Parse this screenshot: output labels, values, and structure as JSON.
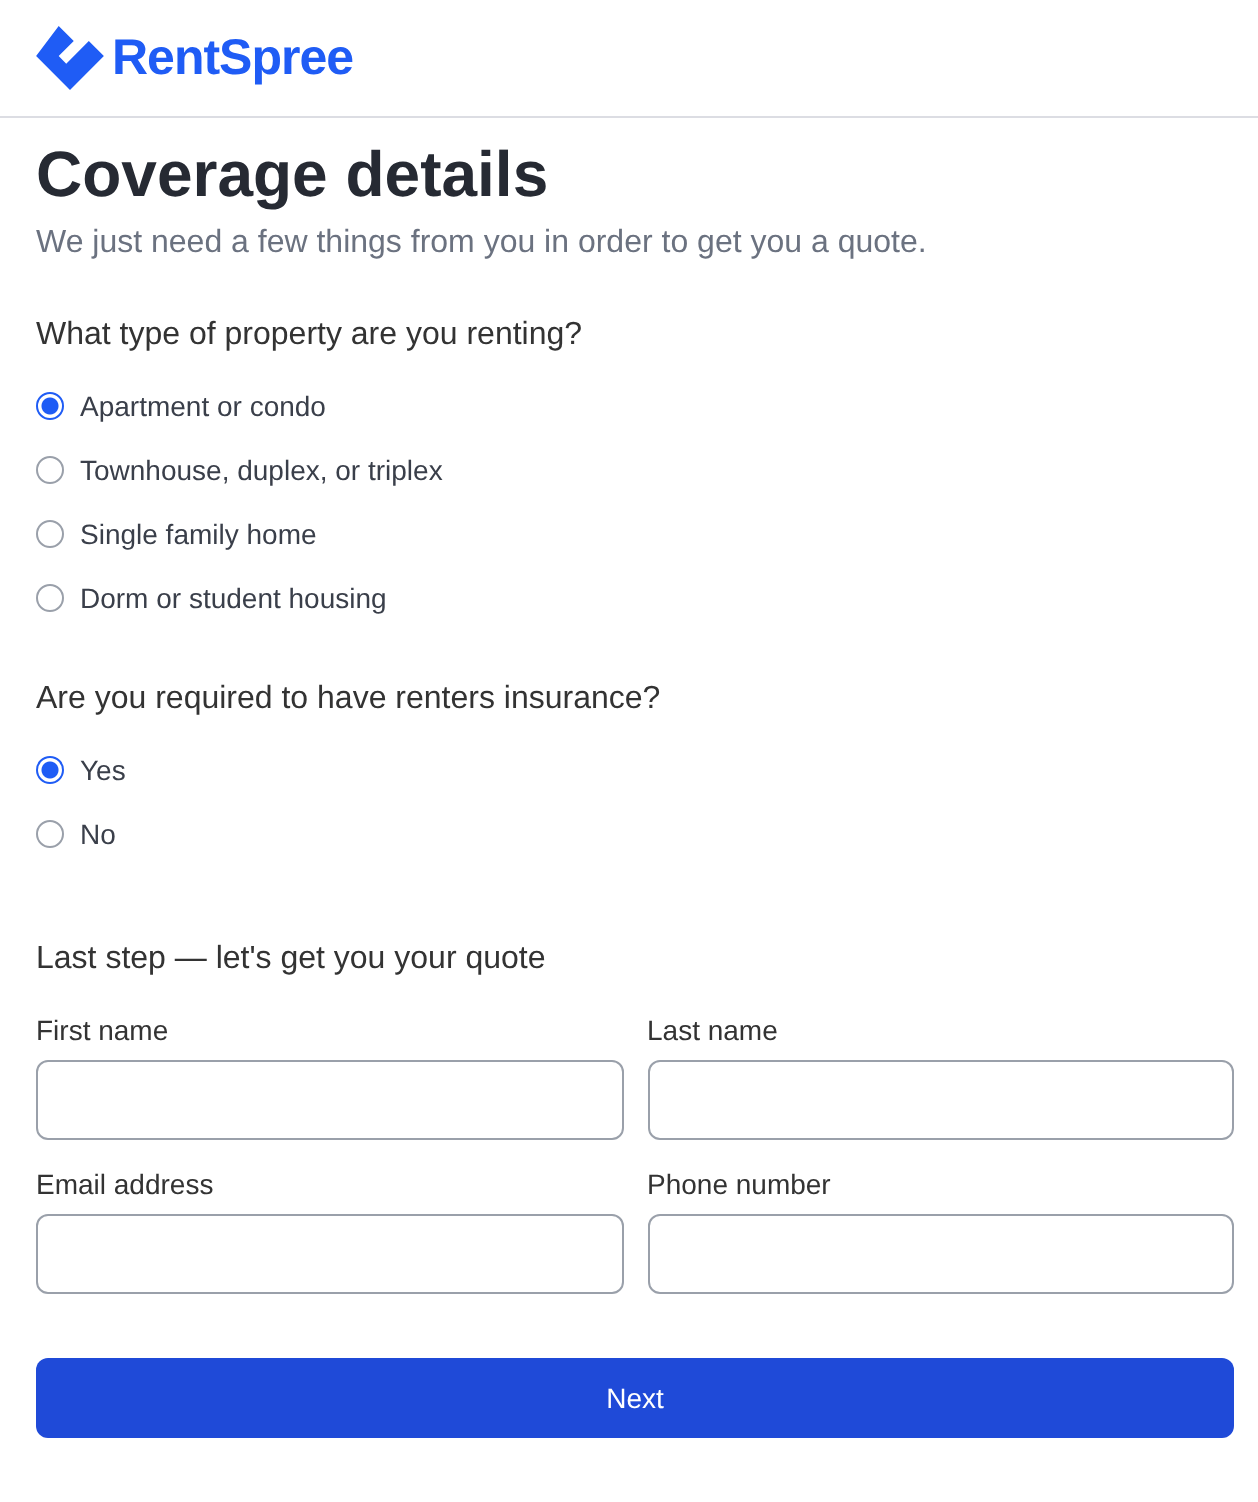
{
  "brand": {
    "name": "RentSpree"
  },
  "title": "Coverage details",
  "subtitle": "We just need a few things from you in order to get you a quote.",
  "questions": [
    {
      "label": "What type of property are you renting?",
      "options": [
        {
          "label": "Apartment or condo",
          "selected": true
        },
        {
          "label": "Townhouse, duplex, or triplex",
          "selected": false
        },
        {
          "label": "Single family home",
          "selected": false
        },
        {
          "label": "Dorm or student housing",
          "selected": false
        }
      ]
    },
    {
      "label": "Are you required to have renters insurance?",
      "options": [
        {
          "label": "Yes",
          "selected": true
        },
        {
          "label": "No",
          "selected": false
        }
      ]
    }
  ],
  "contact": {
    "heading": "Last step — let's get you your quote",
    "fields": [
      {
        "label": "First name"
      },
      {
        "label": "Last name"
      },
      {
        "label": "Email address"
      },
      {
        "label": "Phone number"
      }
    ]
  },
  "button": "Next"
}
